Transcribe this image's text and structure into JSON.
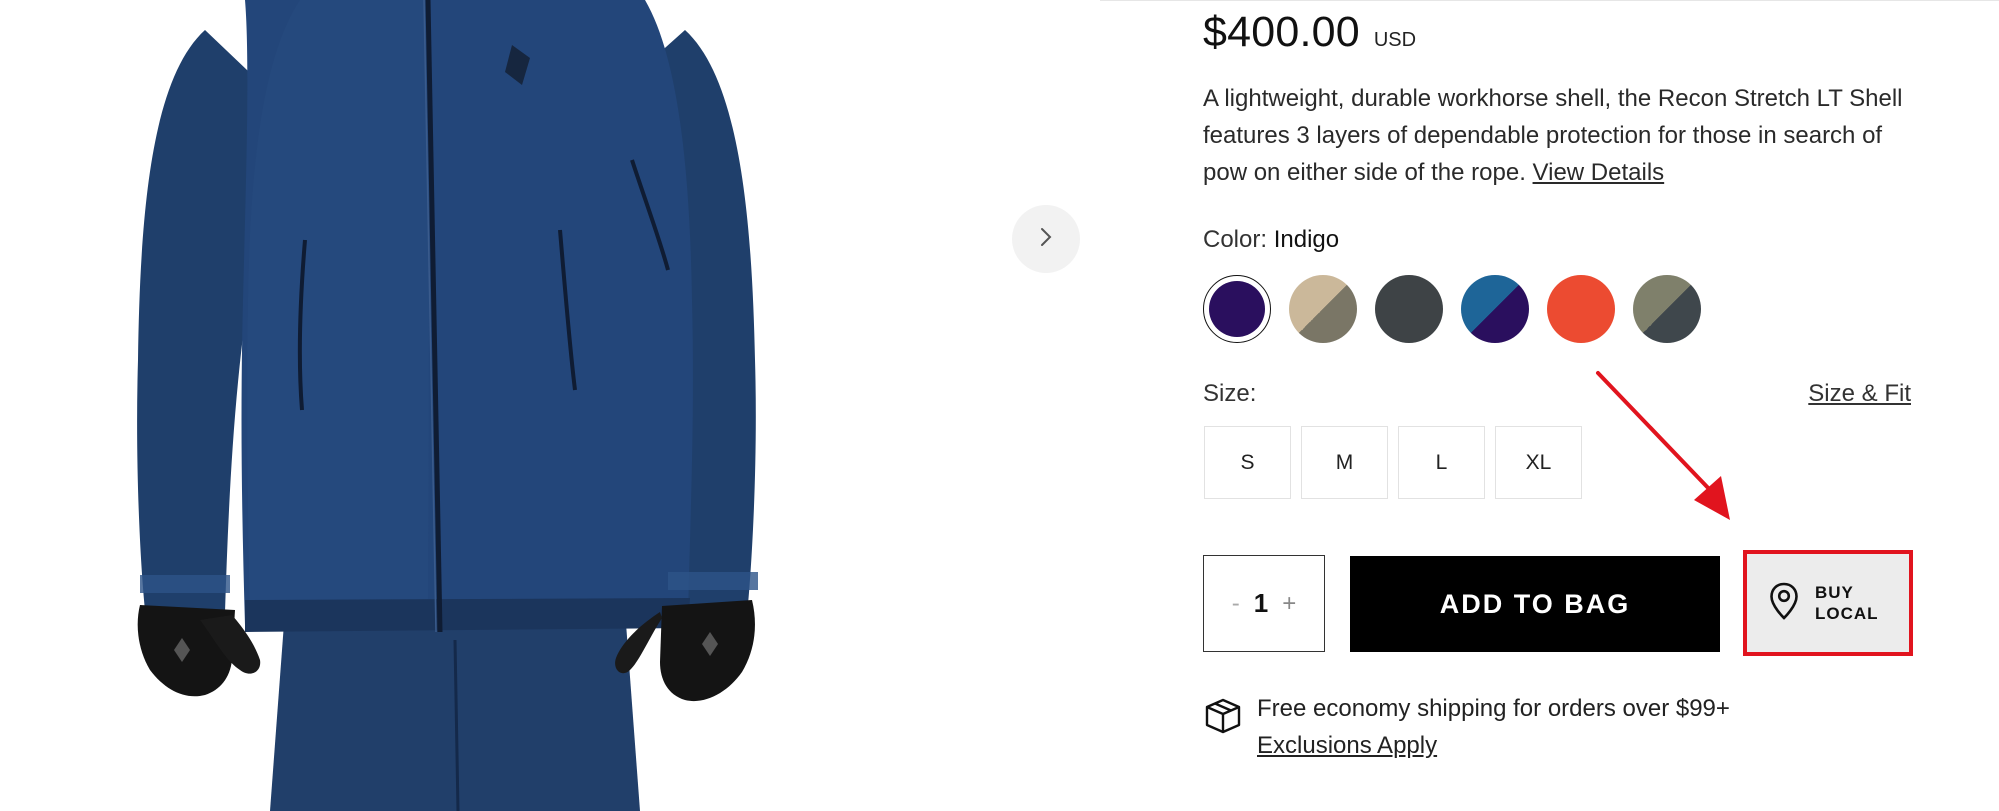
{
  "product": {
    "price": "$400.00",
    "currency": "USD",
    "description_text": "A lightweight, durable workhorse shell, the Recon Stretch LT Shell features 3 layers of dependable protection for those in search of pow on either side of the rope.",
    "view_details_label": "View Details"
  },
  "color": {
    "label": "Color:",
    "selected": "Indigo",
    "swatches": [
      {
        "name": "Indigo",
        "colors": [
          "#2a0f5e",
          "#2a0f5e"
        ],
        "selected": true
      },
      {
        "name": "tan-olive",
        "colors": [
          "#cbb89a",
          "#7a7666"
        ]
      },
      {
        "name": "charcoal",
        "colors": [
          "#3e4346",
          "#3e4346"
        ]
      },
      {
        "name": "blue-indigo",
        "colors": [
          "#1e6598",
          "#2a0f5e"
        ]
      },
      {
        "name": "red-orange",
        "colors": [
          "#ec4b31",
          "#ec4b31"
        ]
      },
      {
        "name": "olive-slate",
        "colors": [
          "#7f806b",
          "#3f474c"
        ]
      }
    ]
  },
  "size": {
    "label": "Size:",
    "fit_link": "Size & Fit",
    "options": [
      "S",
      "M",
      "L",
      "XL"
    ]
  },
  "purchase": {
    "quantity": "1",
    "minus": "-",
    "plus": "+",
    "add_to_bag": "ADD TO BAG",
    "buy_local_line1": "BUY",
    "buy_local_line2": "LOCAL"
  },
  "shipping": {
    "text": "Free economy shipping for orders over $99+",
    "link": "Exclusions Apply"
  },
  "icons": {
    "carousel_next": "chevron-right-icon",
    "buy_local": "map-pin-icon",
    "shipping": "box-icon"
  },
  "colors": {
    "annotation": "#e1141e",
    "button_black": "#000000",
    "jacket_blue": "#1f3f6b"
  }
}
